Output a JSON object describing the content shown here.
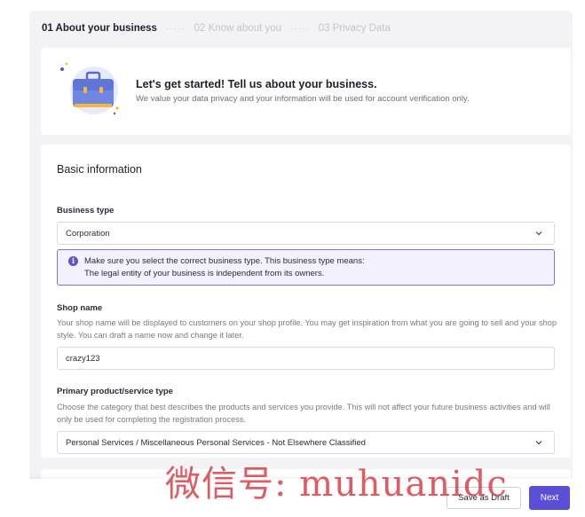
{
  "stepper": {
    "steps": [
      {
        "label": "01 About your business",
        "active": true
      },
      {
        "label": "02 Know about you",
        "active": false
      },
      {
        "label": "03 Privacy Data",
        "active": false
      }
    ],
    "separator": "·····"
  },
  "hero": {
    "title": "Let's get started! Tell us about your business.",
    "subtitle": "We value your data privacy and your information will be used for account verification only.",
    "illustration_icon": "briefcase-icon"
  },
  "form": {
    "section_title": "Basic information",
    "business_type": {
      "label": "Business type",
      "value": "Corporation"
    },
    "info_box": {
      "line1": "Make sure you select the correct business type. This business type means:",
      "line2": "The legal entity of your business is independent from its owners."
    },
    "shop_name": {
      "label": "Shop name",
      "description": "Your shop name will be displayed to customers on your shop profile. You may get inspiration from what you are going to sell and your shop style. You can draft a name now and change it later.",
      "value": "crazy123"
    },
    "product_type": {
      "label": "Primary product/service type",
      "description": "Choose the category that best describes the products and services you provide. This will not affect your future business activities and will only be used for completing the registration process.",
      "value": "Personal Services / Miscellaneous Personal Services - Not Elsewhere Classified"
    }
  },
  "footer": {
    "save_draft_label": "Save as Draft",
    "next_label": "Next"
  },
  "watermark": "微信号: muhuanidc",
  "colors": {
    "accent": "#5b4fd6",
    "info_border": "#7c74d9",
    "info_bg": "#f2f1fd",
    "watermark": "#d62e3a"
  }
}
